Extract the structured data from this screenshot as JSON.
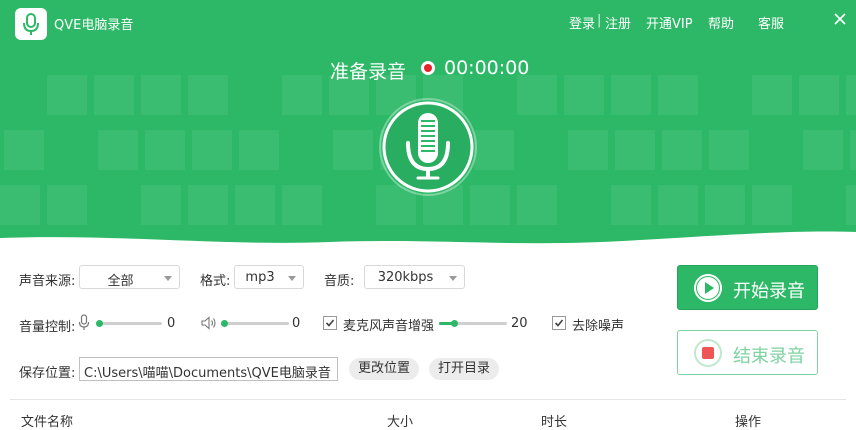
{
  "app": {
    "title": "QVE电脑录音"
  },
  "topnav": {
    "login": "登录",
    "separator": "|",
    "register": "注册",
    "vip": "开通VIP",
    "help": "帮助",
    "service": "客服"
  },
  "status": {
    "text": "准备录音",
    "timer": "00:00:00"
  },
  "icons": {
    "logo": "microphone-icon",
    "close": "close-icon",
    "mic": "microphone-icon",
    "speaker": "speaker-icon",
    "play": "play-icon",
    "stop": "stop-icon"
  },
  "settings": {
    "source_label": "声音来源:",
    "source_value": "全部",
    "format_label": "格式:",
    "format_value": "mp3",
    "quality_label": "音质:",
    "quality_value": "320kbps",
    "volume_label": "音量控制:",
    "mic_volume": 0,
    "speaker_volume": 0,
    "boost_label": "麦克风声音增强",
    "boost_checked": true,
    "boost_value": 20,
    "denoise_label": "去除噪声",
    "denoise_checked": true,
    "save_label": "保存位置:",
    "save_path": "C:\\Users\\喵喵\\Documents\\QVE电脑录音",
    "change_button": "更改位置",
    "open_button": "打开目录"
  },
  "buttons": {
    "start": "开始录音",
    "stop": "结束录音"
  },
  "table": {
    "columns": [
      "文件名称",
      "大小",
      "时长",
      "操作"
    ]
  },
  "colors": {
    "brand": "#2cb866",
    "record_red": "#e6232a",
    "stop_red": "#ee5555"
  }
}
